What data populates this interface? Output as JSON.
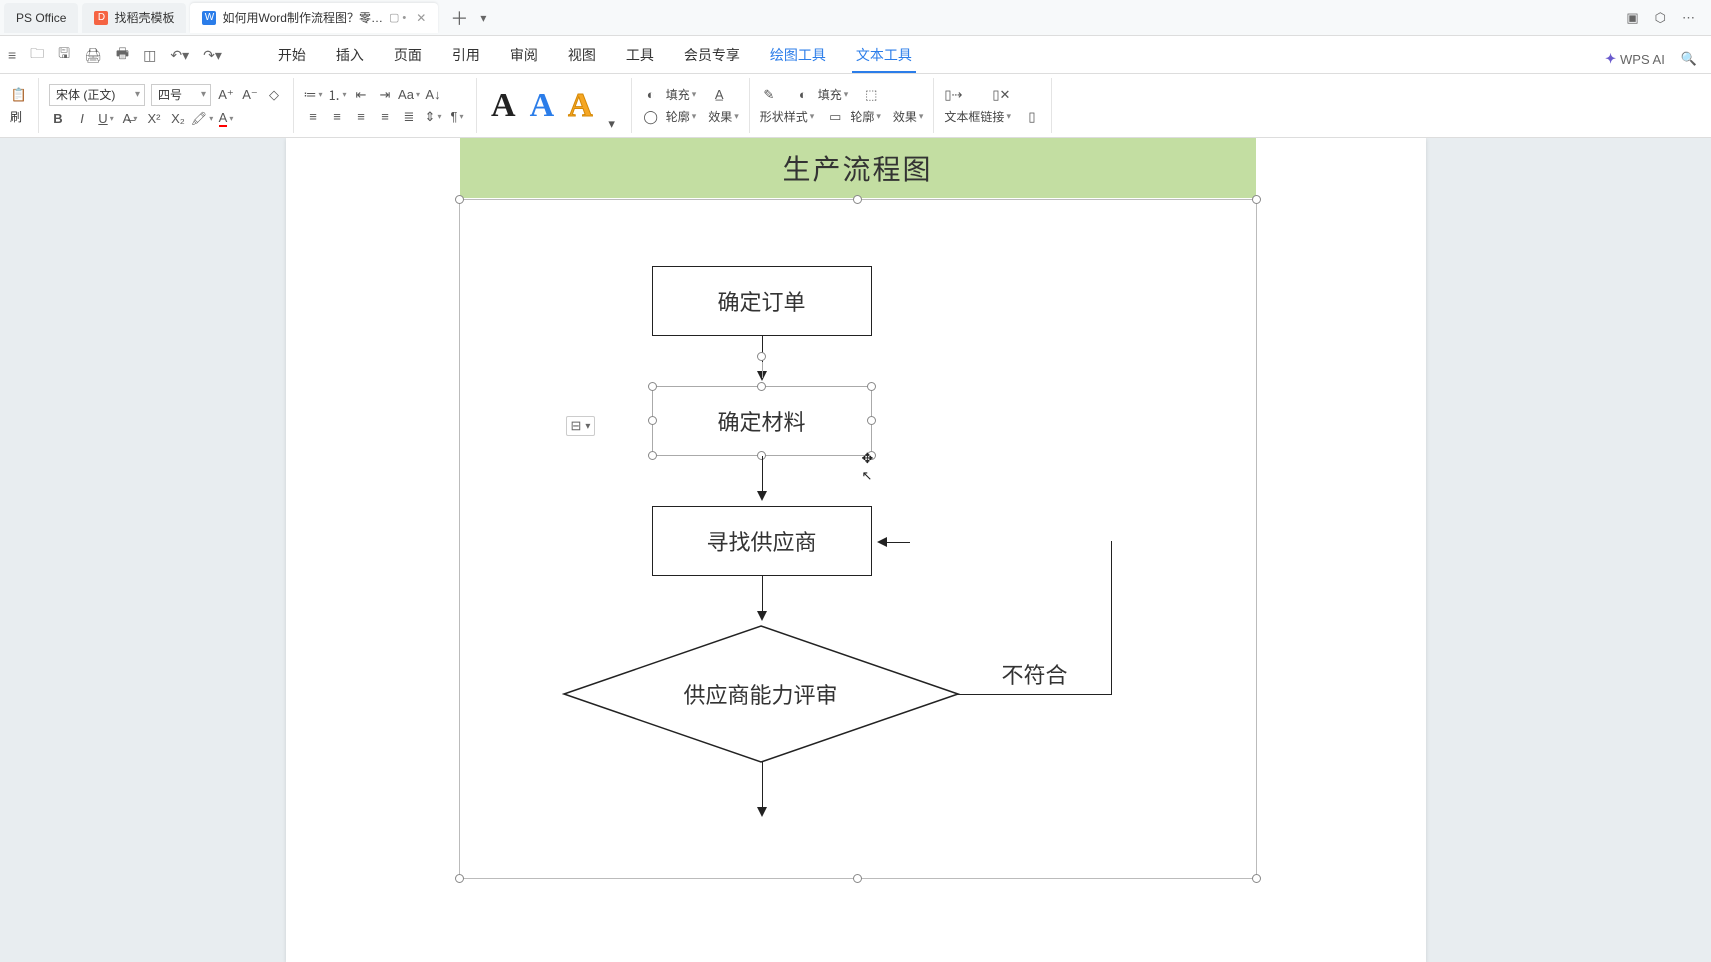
{
  "titlebar": {
    "app_name": "PS Office",
    "tabs": [
      {
        "icon": "orange",
        "label": "找稻壳模板"
      },
      {
        "icon": "blue",
        "label": "如何用Word制作流程图？零…"
      }
    ],
    "right_icons": [
      "layout-icon",
      "cube-icon",
      "menu-icon"
    ]
  },
  "menubar": {
    "quick": [
      "new",
      "open",
      "save",
      "print",
      "print-preview",
      "undo",
      "redo"
    ],
    "tabs": [
      "开始",
      "插入",
      "页面",
      "引用",
      "审阅",
      "视图",
      "工具",
      "会员专享"
    ],
    "tool_tabs": [
      {
        "label": "绘图工具",
        "active": false
      },
      {
        "label": "文本工具",
        "active": true
      }
    ],
    "wps_ai": "WPS AI"
  },
  "ribbon": {
    "font_name": "宋体 (正文)",
    "font_size": "四号",
    "format_brush": "刷",
    "fill": "填充",
    "outline": "轮廓",
    "effect": "效果",
    "shape_style": "形状样式",
    "outline2": "轮廓",
    "effect2": "效果",
    "textbox_link": "文本框链接"
  },
  "flow": {
    "title": "生产流程图",
    "box1": "确定订单",
    "box2": "确定材料",
    "box3": "寻找供应商",
    "diamond": "供应商能力评审",
    "no_label": "不符合",
    "side_tag": "⊟"
  }
}
